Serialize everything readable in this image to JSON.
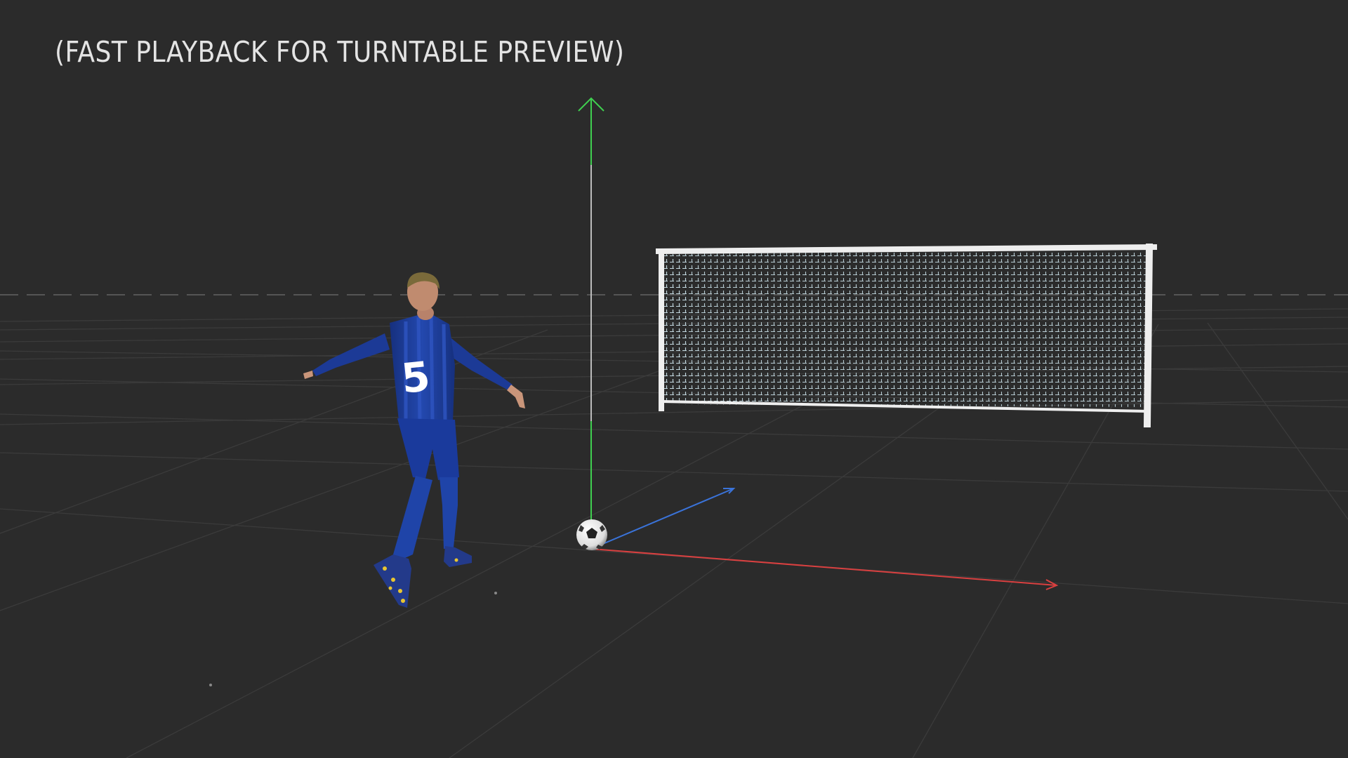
{
  "viewport": {
    "overlay_text": "(FAST PLAYBACK FOR TURNTABLE PREVIEW)",
    "background_color": "#2b2b2b"
  },
  "player": {
    "jersey_number": "5",
    "kit_color": "#1f3f9e",
    "boot_color": "#e8c531"
  },
  "gizmo": {
    "x_axis_color": "#d94040",
    "y_axis_color": "#3fcf4f",
    "z_axis_color": "#3a73d9"
  },
  "goal": {
    "frame_color": "#eeeeee",
    "net_color": "#cfe7ef"
  }
}
